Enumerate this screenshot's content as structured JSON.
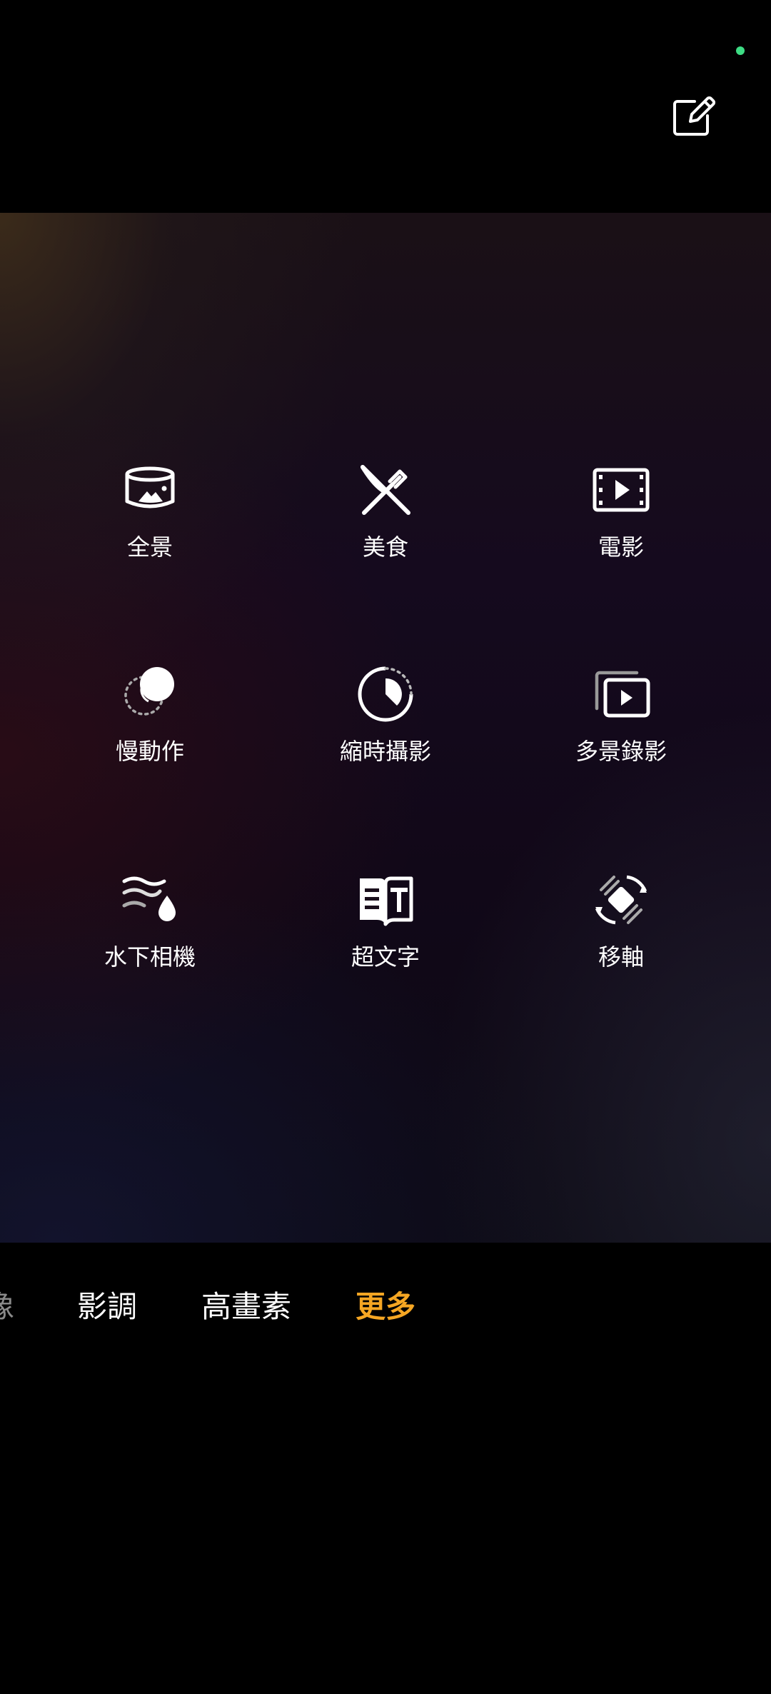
{
  "status": {
    "dot_color": "#3ddc84"
  },
  "header": {
    "edit_icon": "edit-icon"
  },
  "modes": [
    {
      "label": "全景",
      "icon": "panorama-icon"
    },
    {
      "label": "美食",
      "icon": "food-icon"
    },
    {
      "label": "電影",
      "icon": "movie-icon"
    },
    {
      "label": "慢動作",
      "icon": "slow-motion-icon"
    },
    {
      "label": "縮時攝影",
      "icon": "timelapse-icon"
    },
    {
      "label": "多景錄影",
      "icon": "multi-view-video-icon"
    },
    {
      "label": "水下相機",
      "icon": "underwater-icon"
    },
    {
      "label": "超文字",
      "icon": "super-text-icon"
    },
    {
      "label": "移軸",
      "icon": "tilt-shift-icon"
    }
  ],
  "mode_tabs": [
    {
      "label": "像",
      "state": "partial",
      "color": "#8a8a8a"
    },
    {
      "label": "影調",
      "state": "inactive",
      "color": "#ffffff"
    },
    {
      "label": "高畫素",
      "state": "inactive",
      "color": "#ffffff"
    },
    {
      "label": "更多",
      "state": "active",
      "color": "#f5a623"
    }
  ],
  "colors": {
    "accent": "#f5a623",
    "background": "#000000",
    "icon": "#ffffff"
  }
}
